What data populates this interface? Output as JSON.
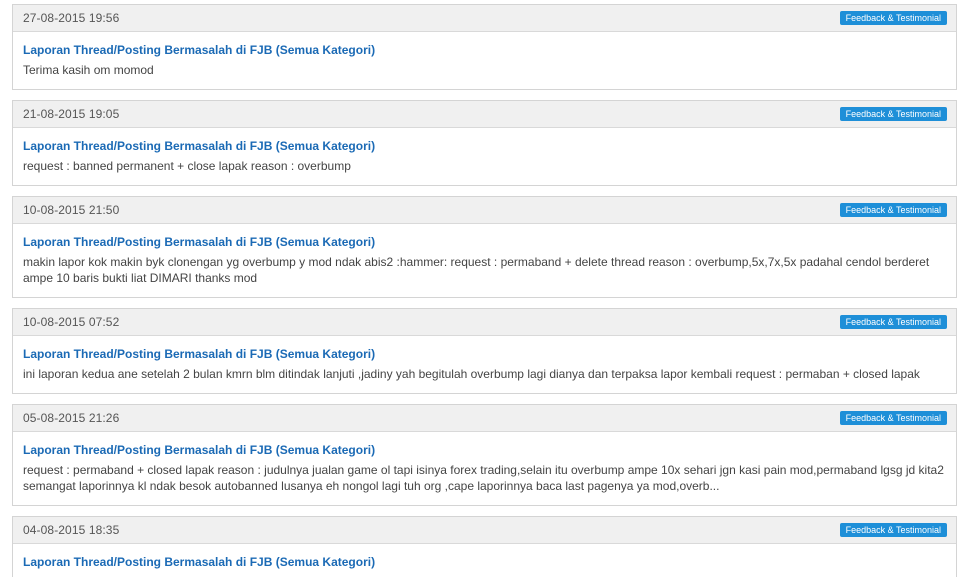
{
  "posts": [
    {
      "date": "27-08-2015 19:56",
      "badge": "Feedback & Testimonial",
      "title": "Laporan Thread/Posting Bermasalah di FJB (Semua Kategori)",
      "text": "Terima kasih om momod"
    },
    {
      "date": "21-08-2015 19:05",
      "badge": "Feedback & Testimonial",
      "title": "Laporan Thread/Posting Bermasalah di FJB (Semua Kategori)",
      "text": "request : banned permanent + close lapak reason : overbump"
    },
    {
      "date": "10-08-2015 21:50",
      "badge": "Feedback & Testimonial",
      "title": "Laporan Thread/Posting Bermasalah di FJB (Semua Kategori)",
      "text": "makin lapor kok makin byk clonengan yg overbump y mod ndak abis2 :hammer: request : permaband + delete thread reason : overbump,5x,7x,5x padahal cendol berderet ampe 10 baris bukti liat DIMARI thanks mod"
    },
    {
      "date": "10-08-2015 07:52",
      "badge": "Feedback & Testimonial",
      "title": "Laporan Thread/Posting Bermasalah di FJB (Semua Kategori)",
      "text": "ini laporan kedua ane setelah 2 bulan kmrn blm ditindak lanjuti ,jadiny yah begitulah overbump lagi dianya dan terpaksa lapor kembali request : permaban + closed lapak"
    },
    {
      "date": "05-08-2015 21:26",
      "badge": "Feedback & Testimonial",
      "title": "Laporan Thread/Posting Bermasalah di FJB (Semua Kategori)",
      "text": "request : permaband + closed lapak reason : judulnya jualan game ol tapi isinya forex trading,selain itu overbump ampe 10x sehari jgn kasi pain mod,permaband lgsg jd kita2 semangat laporinnya kl ndak besok autobanned lusanya eh nongol lagi tuh org ,cape laporinnya baca last pagenya ya mod,overb..."
    },
    {
      "date": "04-08-2015 18:35",
      "badge": "Feedback & Testimonial",
      "title": "Laporan Thread/Posting Bermasalah di FJB (Semua Kategori)",
      "text": ""
    }
  ]
}
